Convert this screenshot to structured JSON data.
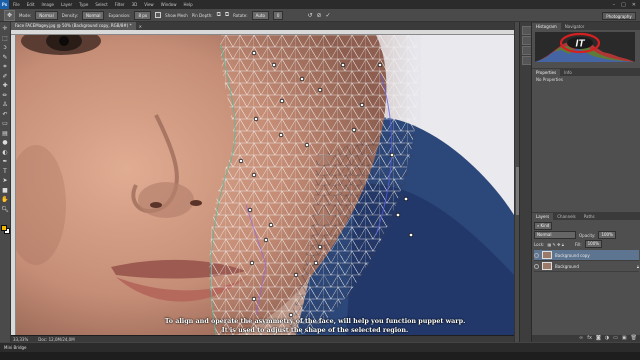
{
  "app": {
    "logo": "Ps"
  },
  "menu": [
    "File",
    "Edit",
    "Image",
    "Layer",
    "Type",
    "Select",
    "Filter",
    "3D",
    "View",
    "Window",
    "Help"
  ],
  "options": {
    "mode_label": "Mode:",
    "mode_value": "Normal",
    "density_label": "Density:",
    "density_value": "Normal",
    "expansion_label": "Expansion:",
    "expansion_value": "8 px",
    "show_mesh_label": "Show Mesh",
    "pin_depth_label": "Pin Depth:",
    "rotate_label": "Rotate:",
    "rotate_value": "Auto",
    "workspace": "Photography"
  },
  "document": {
    "tab_title": "Face FACEMagey.jpg @ 50% (Background copy, RGB/8#) *",
    "zoom": "33,33%",
    "doc_info": "Doc: 12,0M/24,0M"
  },
  "panels": {
    "top_tabs": [
      "Histogram",
      "Navigator"
    ],
    "props_tabs": [
      "Properties",
      "Info"
    ],
    "props_body": "No Properties",
    "layers_tabs": [
      "Layers",
      "Channels",
      "Paths"
    ],
    "blend_mode": "Normal",
    "opacity_label": "Opacity:",
    "opacity_value": "100%",
    "lock_label": "Lock:",
    "fill_label": "Fill:",
    "fill_value": "100%",
    "layers": [
      {
        "name": "Background copy",
        "active": true
      },
      {
        "name": "Background",
        "active": false
      }
    ]
  },
  "bottom_bar": {
    "label": "Mini Bridge"
  },
  "watermark": {
    "text": "IT"
  },
  "subtitle": {
    "line1": "To align and operate the asymmetry of the face, will help you function puppet warp.",
    "line2": "It is used to adjust the shape of the selected region."
  },
  "colors": {
    "foreground": "#f2b700",
    "background": "#ffffff",
    "accent": "#5e7592"
  }
}
